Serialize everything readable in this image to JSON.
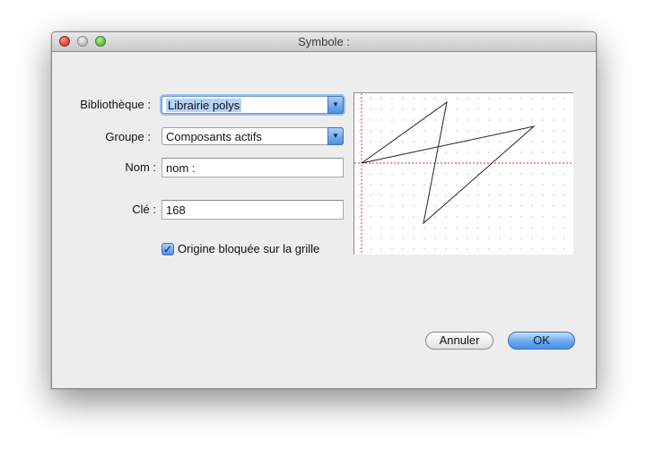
{
  "window": {
    "title": "Symbole :"
  },
  "form": {
    "library_label": "Bibliothèque :",
    "library_value": "Librairie polys",
    "group_label": "Groupe :",
    "group_value": "Composants actifs",
    "name_label": "Nom :",
    "name_value": "nom :",
    "key_label": "Clé :",
    "key_value": "168",
    "origin_checkbox_label": "Origine bloquée sur la grille",
    "origin_checked": true
  },
  "buttons": {
    "cancel": "Annuler",
    "ok": "OK"
  },
  "icons": {
    "popup_arrow": "chevron-down-icon",
    "checkmark": "checkmark-icon"
  },
  "colors": {
    "accent": "#4d8fe0",
    "origin_axis": "#e03030",
    "grid_dot": "#9a9a9a",
    "shape_stroke": "#222222"
  }
}
